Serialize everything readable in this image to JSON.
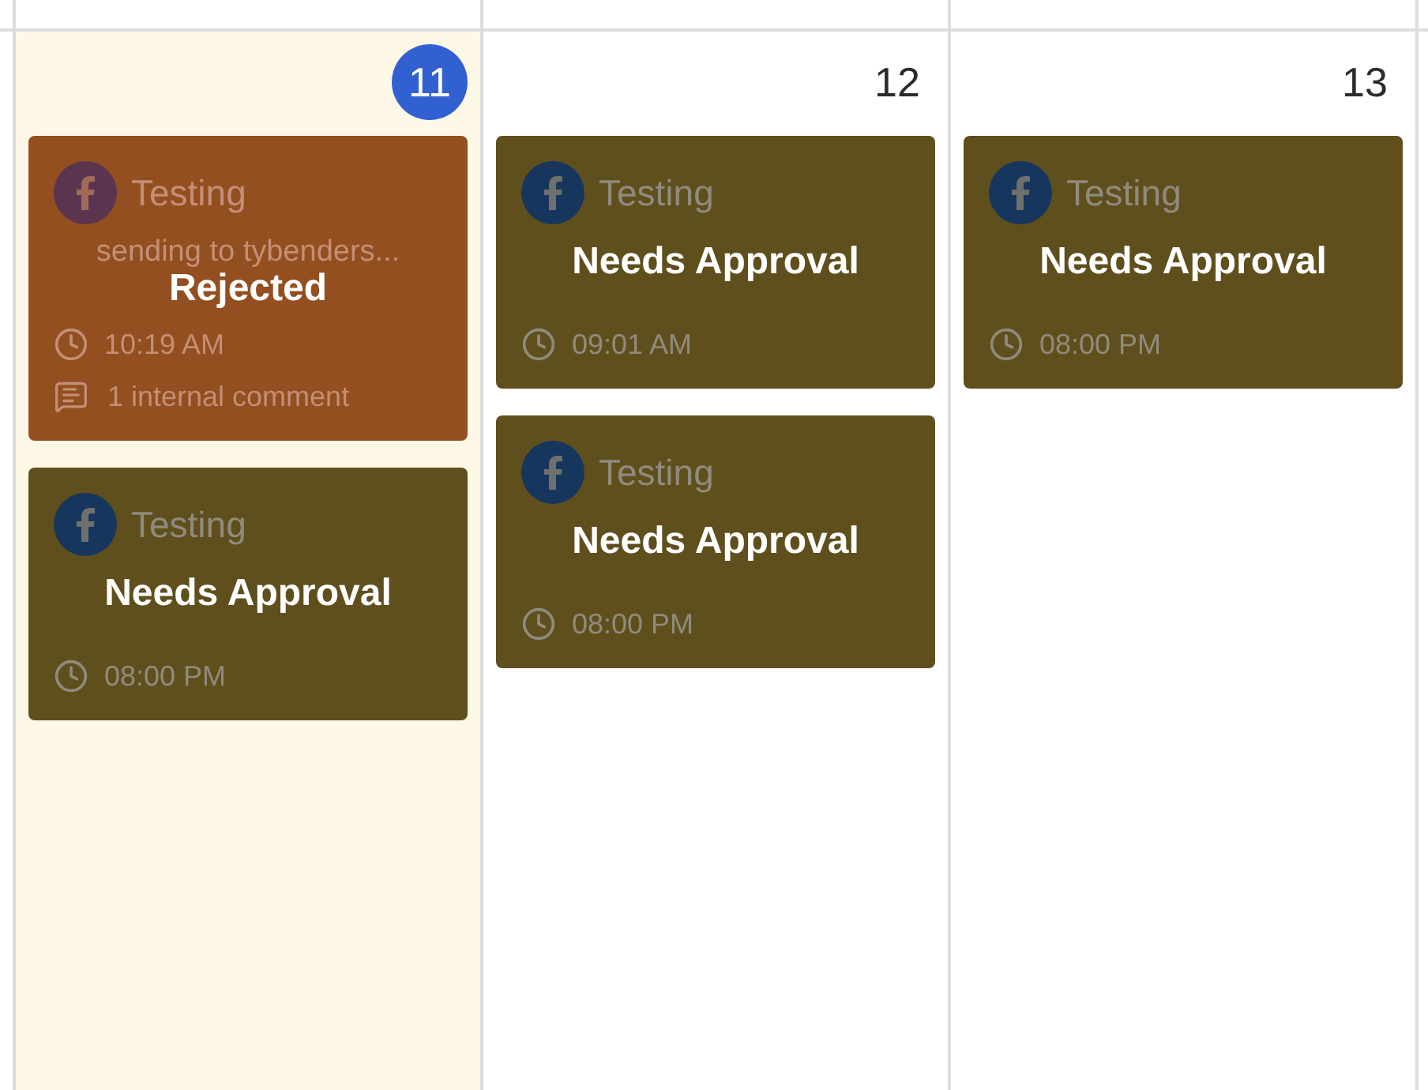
{
  "calendar": {
    "days": [
      {
        "date": "11",
        "today": true,
        "events": [
          {
            "kind": "rejected",
            "status": "Rejected",
            "title": "Testing",
            "text": "sending to tybenders...",
            "time": "10:19 AM",
            "comment": "1 internal comment"
          },
          {
            "kind": "pending",
            "status": "Needs Approval",
            "title": "Testing",
            "time": "08:00 PM"
          }
        ]
      },
      {
        "date": "12",
        "today": false,
        "events": [
          {
            "kind": "pending",
            "status": "Needs Approval",
            "title": "Testing",
            "time": "09:01 AM"
          },
          {
            "kind": "pending",
            "status": "Needs Approval",
            "title": "Testing",
            "time": "08:00 PM"
          }
        ]
      },
      {
        "date": "13",
        "today": false,
        "events": [
          {
            "kind": "pending",
            "status": "Needs Approval",
            "title": "Testing",
            "time": "08:00 PM"
          }
        ]
      }
    ]
  }
}
